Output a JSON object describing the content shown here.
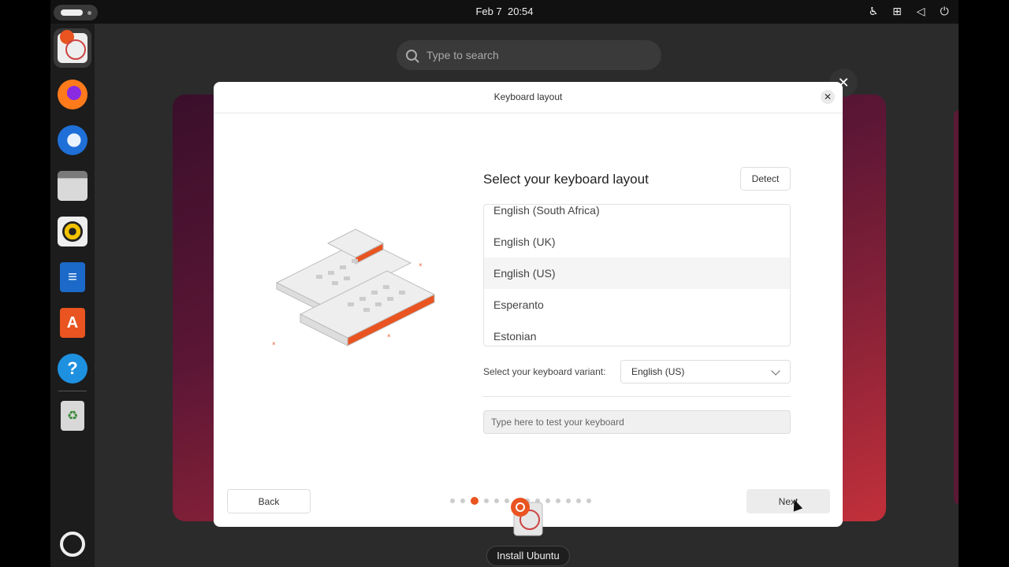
{
  "topbar": {
    "date": "Feb 7",
    "time": "20:54",
    "tray_icons": [
      "accessibility-icon",
      "network-icon",
      "volume-icon",
      "power-icon"
    ]
  },
  "overview": {
    "search_placeholder": "Type to search",
    "window_label": "Install Ubuntu"
  },
  "dock": {
    "apps": [
      "installer-icon",
      "firefox-icon",
      "thunderbird-icon",
      "files-icon",
      "rhythmbox-icon",
      "writer-icon",
      "app-center-icon",
      "help-icon",
      "trash-icon",
      "show-apps-icon"
    ]
  },
  "dialog": {
    "title": "Keyboard layout",
    "heading": "Select your keyboard layout",
    "detect_label": "Detect",
    "layouts": [
      "English (South Africa)",
      "English (UK)",
      "English (US)",
      "Esperanto",
      "Estonian"
    ],
    "selected_layout": "English (US)",
    "variant_label": "Select your keyboard variant:",
    "variant_value": "English (US)",
    "test_placeholder": "Type here to test your keyboard",
    "back_label": "Back",
    "next_label": "Next",
    "progress": {
      "steps": 14,
      "current": 3
    }
  },
  "colors": {
    "accent": "#e95420",
    "wallpaper": "#8a2238"
  }
}
